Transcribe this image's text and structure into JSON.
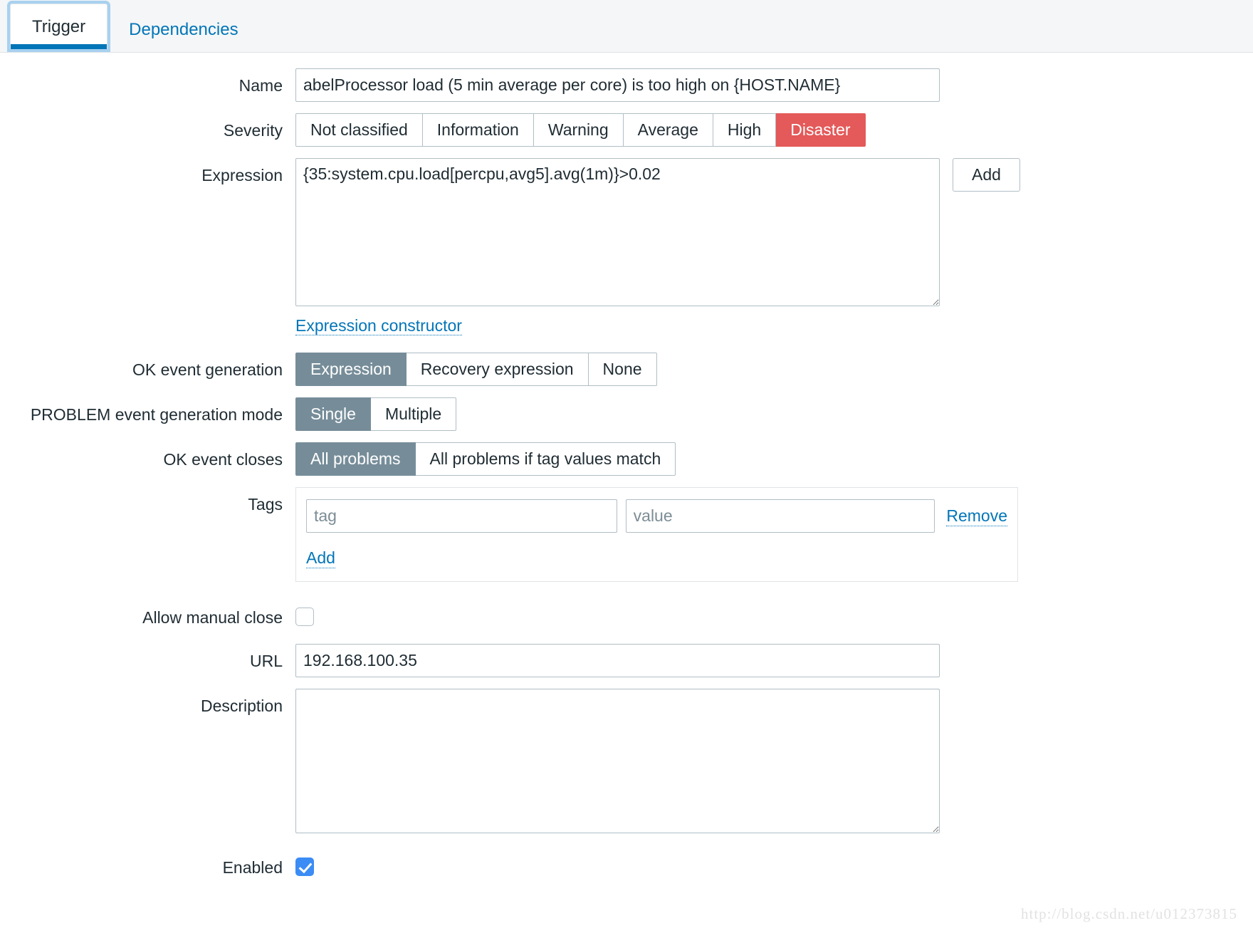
{
  "tabs": [
    {
      "label": "Trigger",
      "active": true
    },
    {
      "label": "Dependencies",
      "active": false
    }
  ],
  "form": {
    "name": {
      "label": "Name",
      "value": "abelProcessor load (5 min average per core) is too high on {HOST.NAME}"
    },
    "severity": {
      "label": "Severity",
      "options": [
        "Not classified",
        "Information",
        "Warning",
        "Average",
        "High",
        "Disaster"
      ],
      "selected": "Disaster",
      "selected_color": "#e45959"
    },
    "expression": {
      "label": "Expression",
      "value": "{35:system.cpu.load[percpu,avg5].avg(1m)}>0.02",
      "add_button": "Add",
      "constructor_link": "Expression constructor"
    },
    "ok_event_generation": {
      "label": "OK event generation",
      "options": [
        "Expression",
        "Recovery expression",
        "None"
      ],
      "selected": "Expression"
    },
    "problem_event_generation_mode": {
      "label": "PROBLEM event generation mode",
      "options": [
        "Single",
        "Multiple"
      ],
      "selected": "Single"
    },
    "ok_event_closes": {
      "label": "OK event closes",
      "options": [
        "All problems",
        "All problems if tag values match"
      ],
      "selected": "All problems"
    },
    "tags": {
      "label": "Tags",
      "rows": [
        {
          "tag_value": "",
          "tag_placeholder": "tag",
          "value_value": "",
          "value_placeholder": "value",
          "remove_label": "Remove"
        }
      ],
      "add_label": "Add"
    },
    "allow_manual_close": {
      "label": "Allow manual close",
      "checked": false
    },
    "url": {
      "label": "URL",
      "value": "192.168.100.35"
    },
    "description": {
      "label": "Description",
      "value": "",
      "placeholder": ""
    },
    "enabled": {
      "label": "Enabled",
      "checked": true,
      "accent_color": "#3b8cf5"
    }
  },
  "watermark": "http://blog.csdn.net/u012373815",
  "theme": {
    "selected_segment": "#768d99",
    "link_blue": "#0275b8",
    "border": "#b0bec5"
  }
}
